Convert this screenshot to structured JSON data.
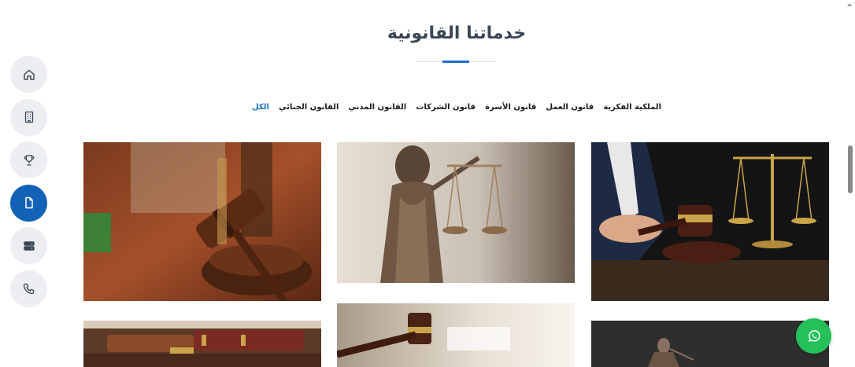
{
  "section": {
    "title": "خدماتنا القانونية"
  },
  "filters": [
    {
      "label": "الكل",
      "active": true
    },
    {
      "label": "القانون الجنائي",
      "active": false
    },
    {
      "label": "القانون المدني",
      "active": false
    },
    {
      "label": "قانون الشركات",
      "active": false
    },
    {
      "label": "قانون الأسرة",
      "active": false
    },
    {
      "label": "قانون العمل",
      "active": false
    },
    {
      "label": "الملكية الفكرية",
      "active": false
    }
  ],
  "side_nav": {
    "items": [
      {
        "icon": "home-icon",
        "active": false
      },
      {
        "icon": "building-icon",
        "active": false
      },
      {
        "icon": "trophy-icon",
        "active": false
      },
      {
        "icon": "document-icon",
        "active": true
      },
      {
        "icon": "server-icon",
        "active": false
      },
      {
        "icon": "phone-icon",
        "active": false
      }
    ],
    "accent": "#1262b7"
  },
  "gallery": {
    "items": [
      {
        "depicts": "gavel-on-wooden-desk"
      },
      {
        "depicts": "lady-justice-statue"
      },
      {
        "depicts": "judge-gavel-and-scales"
      },
      {
        "depicts": "law-books-and-gavel"
      },
      {
        "depicts": "gavel-with-documents"
      },
      {
        "depicts": "justice-statue-dark"
      }
    ]
  },
  "whatsapp": {
    "icon": "whatsapp-icon",
    "color": "#25c05a"
  }
}
